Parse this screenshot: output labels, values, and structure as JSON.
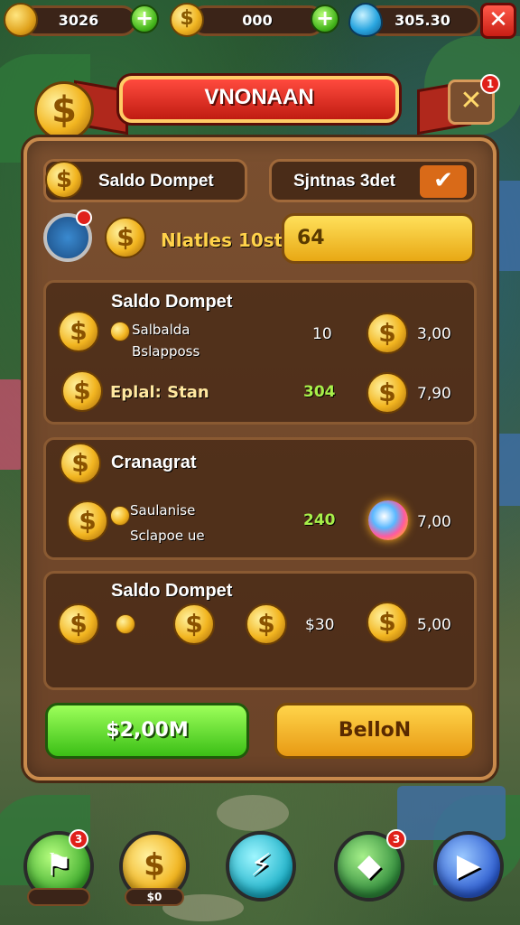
{
  "resources": [
    {
      "icon": "gold-bar-icon",
      "value": "3026"
    },
    {
      "icon": "coin-icon",
      "value": "000"
    },
    {
      "icon": "gem-icon",
      "value": "305.30"
    }
  ],
  "banner": {
    "title": "VNONAAN"
  },
  "wallet": {
    "label": "Saldo Dompet",
    "right_label": "Sjntnas 3det"
  },
  "goal": {
    "label": "Nlatles 10st",
    "bar_value": "64",
    "badge": ""
  },
  "sections": [
    {
      "title": "Saldo Dompet",
      "sub1": "Salbalda",
      "sub2": "Bslapposs",
      "num_white": "10",
      "val1": "3,00",
      "row2_label": "Eplal: Stan",
      "num_green": "304",
      "val2": "7,90"
    },
    {
      "title": "Cranagrat",
      "sub1": "Saulanise",
      "sub2": "Sclapoe ue",
      "num_green": "240",
      "val1": "7,00"
    },
    {
      "title": "Saldo Dompet",
      "num_white": "$30",
      "val1": "5,00"
    }
  ],
  "buttons": {
    "primary": "$2,00M",
    "secondary": "BelloN"
  },
  "nav": {
    "label1": "",
    "label2": "$0"
  },
  "badges": {
    "banner_close": "1",
    "goal": "",
    "nav1": "3",
    "nav4": "3"
  },
  "colors": {
    "accent_red": "#c01c12",
    "gold": "#f2b520",
    "panel": "#6b4328",
    "green": "#3bbf16"
  }
}
